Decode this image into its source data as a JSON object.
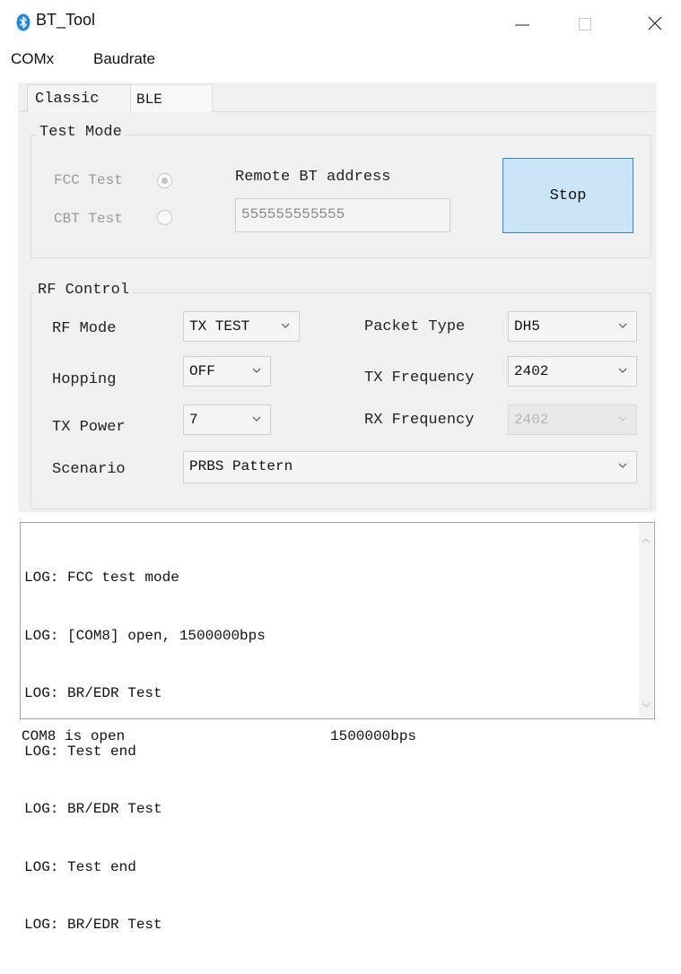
{
  "window": {
    "title": "BT_Tool",
    "icon": "bluetooth-icon"
  },
  "menu": {
    "items": [
      "COMx",
      "Baudrate"
    ]
  },
  "tabs": [
    {
      "label": "Classic",
      "active": true
    },
    {
      "label": "BLE",
      "active": false
    }
  ],
  "test_mode": {
    "title": "Test Mode",
    "fcc_label": "FCC Test",
    "fcc_selected": true,
    "cbt_label": "CBT Test",
    "cbt_selected": false,
    "remote_label": "Remote BT address",
    "remote_value": "555555555555",
    "stop_label": "Stop"
  },
  "rf_control": {
    "title": "RF Control",
    "rf_mode_label": "RF Mode",
    "rf_mode_value": "TX TEST",
    "hopping_label": "Hopping",
    "hopping_value": "OFF",
    "tx_power_label": "TX Power",
    "tx_power_value": "7",
    "scenario_label": "Scenario",
    "scenario_value": "PRBS Pattern",
    "packet_type_label": "Packet Type",
    "packet_type_value": "DH5",
    "tx_freq_label": "TX Frequency",
    "tx_freq_value": "2402",
    "rx_freq_label": "RX Frequency",
    "rx_freq_value": "2402"
  },
  "log": {
    "lines": [
      "LOG: FCC test mode",
      "LOG: [COM8] open, 1500000bps",
      "LOG: BR/EDR Test",
      "LOG: Test end",
      "LOG: BR/EDR Test",
      "LOG: Test end",
      "LOG: BR/EDR Test"
    ]
  },
  "status": {
    "port": "COM8 is open",
    "baud": "1500000bps"
  },
  "colors": {
    "accent_blue": "#1e88e5",
    "stop_bg": "#cce4f7",
    "stop_border": "#3a82c9"
  }
}
